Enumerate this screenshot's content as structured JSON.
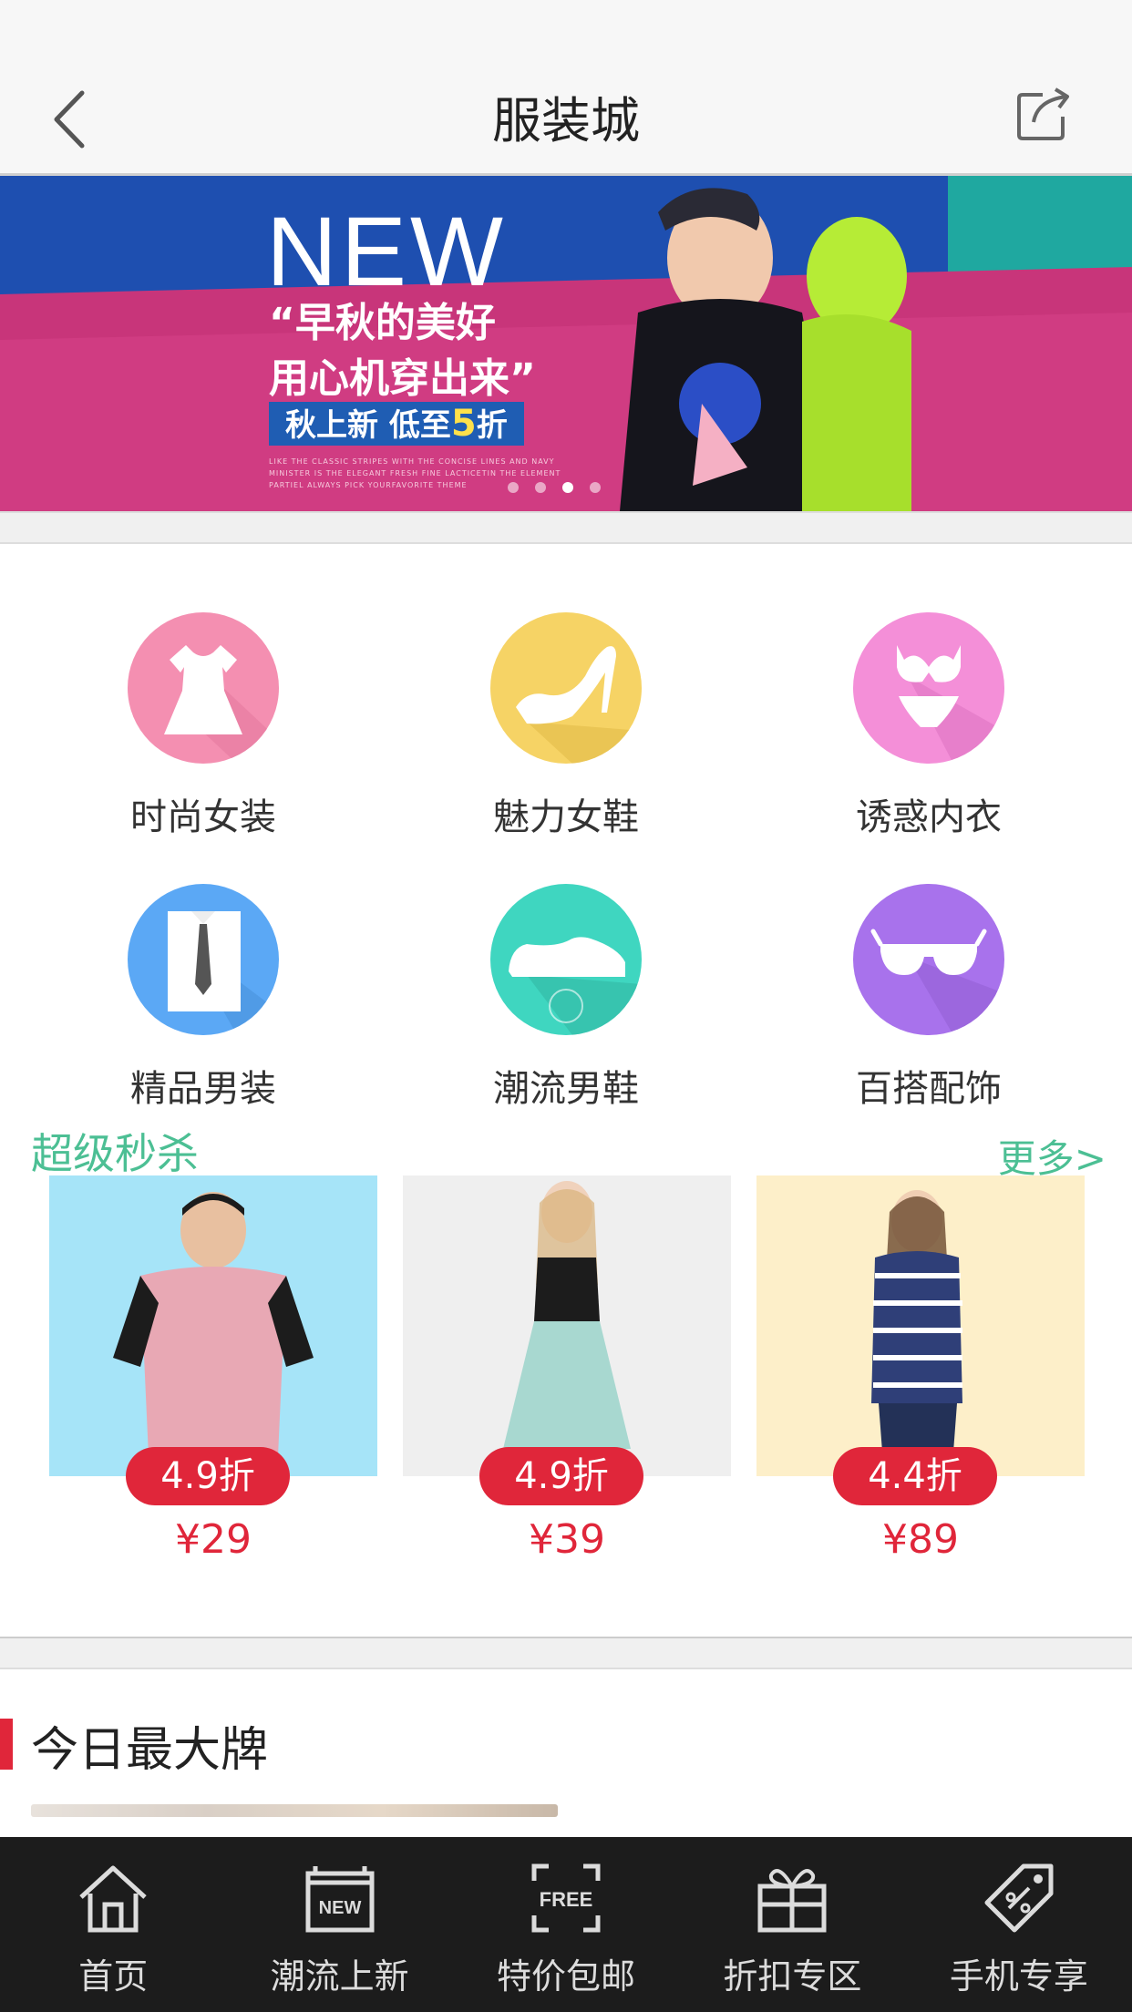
{
  "nav": {
    "title": "服装城",
    "back_icon": "chevron-left-icon",
    "share_icon": "share-icon"
  },
  "banner": {
    "headline": "NEW",
    "line1": "“早秋的美好",
    "line2": "用心机穿出来”",
    "promo_prefix": "秋上新 低至",
    "promo_value": "5",
    "promo_suffix": "折",
    "fine_print": "LIKE THE CLASSIC STRIPES WITH THE CONCISE LINES AND NAVY MINISTER IS THE ELEGANT FRESH FINE LACTICETIN THE ELEMENT PARTIEL ALWAYS PICK YOURFAVORITE THEME",
    "slide_count": 4,
    "active_slide": 3
  },
  "categories": [
    {
      "label": "时尚女装",
      "icon": "dress-icon",
      "color": "#f48fb1"
    },
    {
      "label": "魅力女鞋",
      "icon": "high-heel-icon",
      "color": "#f6d365"
    },
    {
      "label": "诱惑内衣",
      "icon": "lingerie-icon",
      "color": "#f48fd8"
    },
    {
      "label": "精品男装",
      "icon": "shirt-tie-icon",
      "color": "#5ba8f5"
    },
    {
      "label": "潮流男鞋",
      "icon": "mens-shoe-icon",
      "color": "#3fd6c0"
    },
    {
      "label": "百搭配饰",
      "icon": "sunglasses-icon",
      "color": "#a872ec"
    }
  ],
  "flash_sale": {
    "title": "超级秒杀",
    "more": "更多>",
    "items": [
      {
        "discount": "4.9折",
        "price": "¥29",
        "bg": "#a6e4f8"
      },
      {
        "discount": "4.9折",
        "price": "¥39",
        "bg": "#efefef"
      },
      {
        "discount": "4.4折",
        "price": "¥89",
        "bg": "#fdefc9"
      }
    ]
  },
  "today": {
    "title": "今日最大牌"
  },
  "tabbar": [
    {
      "label": "首页",
      "icon": "home-icon"
    },
    {
      "label": "潮流上新",
      "icon": "new-badge-icon",
      "icon_text": "NEW"
    },
    {
      "label": "特价包邮",
      "icon": "free-shipping-icon",
      "icon_text": "FREE"
    },
    {
      "label": "折扣专区",
      "icon": "gift-icon"
    },
    {
      "label": "手机专享",
      "icon": "price-tag-icon"
    }
  ],
  "colors": {
    "accent_red": "#e0263a",
    "section_green": "#4cbf94",
    "tabbar_bg": "#1c1c1c"
  }
}
